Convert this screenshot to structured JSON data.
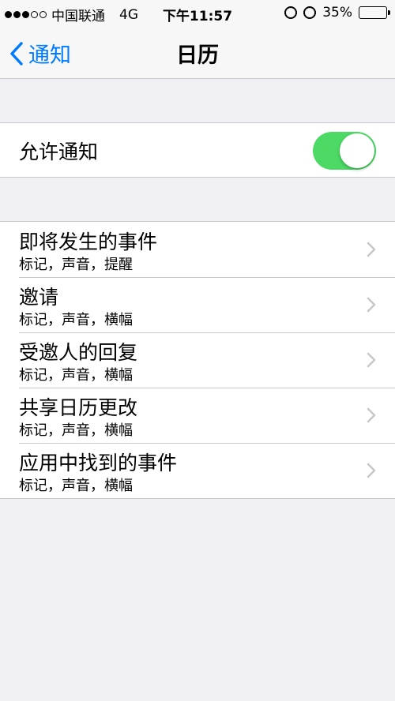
{
  "status_bar": {
    "carrier": "中国联通",
    "network": "4G",
    "time": "下午11:57",
    "battery_percent": "35%",
    "battery_level": 0.35,
    "signal_bars": 3
  },
  "nav": {
    "back_label": "通知",
    "title": "日历"
  },
  "allow": {
    "label": "允许通知",
    "enabled": true,
    "on_color": "#4cd964"
  },
  "rows": [
    {
      "title": "即将发生的事件",
      "subtitle": "标记，声音，提醒"
    },
    {
      "title": "邀请",
      "subtitle": "标记，声音，横幅"
    },
    {
      "title": "受邀人的回复",
      "subtitle": "标记，声音，横幅"
    },
    {
      "title": "共享日历更改",
      "subtitle": "标记，声音，横幅"
    },
    {
      "title": "应用中找到的事件",
      "subtitle": "标记，声音，横幅"
    }
  ],
  "colors": {
    "accent": "#007aff",
    "background": "#efeff4"
  }
}
